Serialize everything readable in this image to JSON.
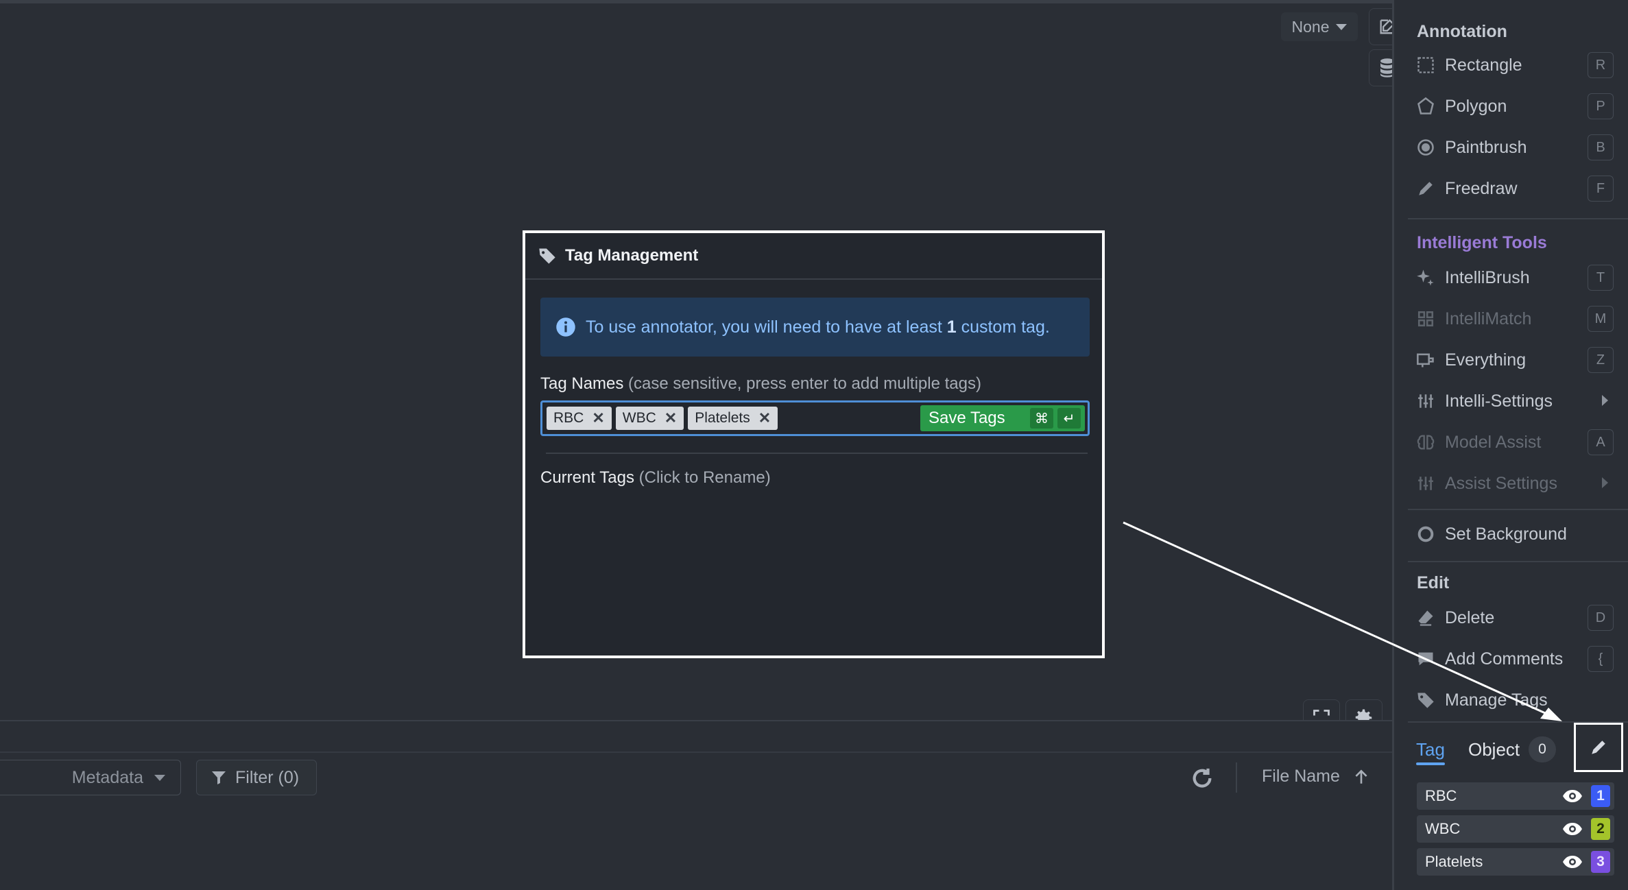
{
  "toolbar": {
    "view_mode": "None"
  },
  "sidebar": {
    "annotation_title": "Annotation",
    "annotation_tools": [
      {
        "label": "Rectangle",
        "key": "R"
      },
      {
        "label": "Polygon",
        "key": "P"
      },
      {
        "label": "Paintbrush",
        "key": "B"
      },
      {
        "label": "Freedraw",
        "key": "F"
      }
    ],
    "intelligent_title": "Intelligent Tools",
    "intelligent_tools": [
      {
        "label": "IntelliBrush",
        "key": "T"
      },
      {
        "label": "IntelliMatch",
        "key": "M"
      },
      {
        "label": "Everything",
        "key": "Z"
      },
      {
        "label": "Intelli-Settings"
      },
      {
        "label": "Model Assist",
        "key": "A"
      },
      {
        "label": "Assist Settings"
      }
    ],
    "set_background": "Set Background",
    "edit_title": "Edit",
    "edit_tools": [
      {
        "label": "Delete",
        "key": "D"
      },
      {
        "label": "Add Comments",
        "key": "{"
      },
      {
        "label": "Manage Tags"
      }
    ],
    "tabs": {
      "tag": "Tag",
      "object": "Object",
      "object_count": "0"
    },
    "tags": [
      {
        "name": "RBC",
        "index": "1",
        "color": "#3b5cf5"
      },
      {
        "name": "WBC",
        "index": "2",
        "color": "#a4c42a"
      },
      {
        "name": "Platelets",
        "index": "3",
        "color": "#7a4fe0"
      }
    ]
  },
  "modal": {
    "title": "Tag Management",
    "info_pre": "To use annotator, you will need to have at least ",
    "info_bold": "1",
    "info_post": " custom tag.",
    "tag_names_label": "Tag Names",
    "tag_names_hint": " (case sensitive, press enter to add multiple tags)",
    "chips": [
      "RBC",
      "WBC",
      "Platelets"
    ],
    "save_label": "Save Tags",
    "save_key1": "⌘",
    "save_key2": "↵",
    "current_label": "Current Tags",
    "current_hint": " (Click to Rename)"
  },
  "bottom": {
    "metadata": "Metadata",
    "filter": "Filter (0)",
    "sort": "File Name"
  }
}
